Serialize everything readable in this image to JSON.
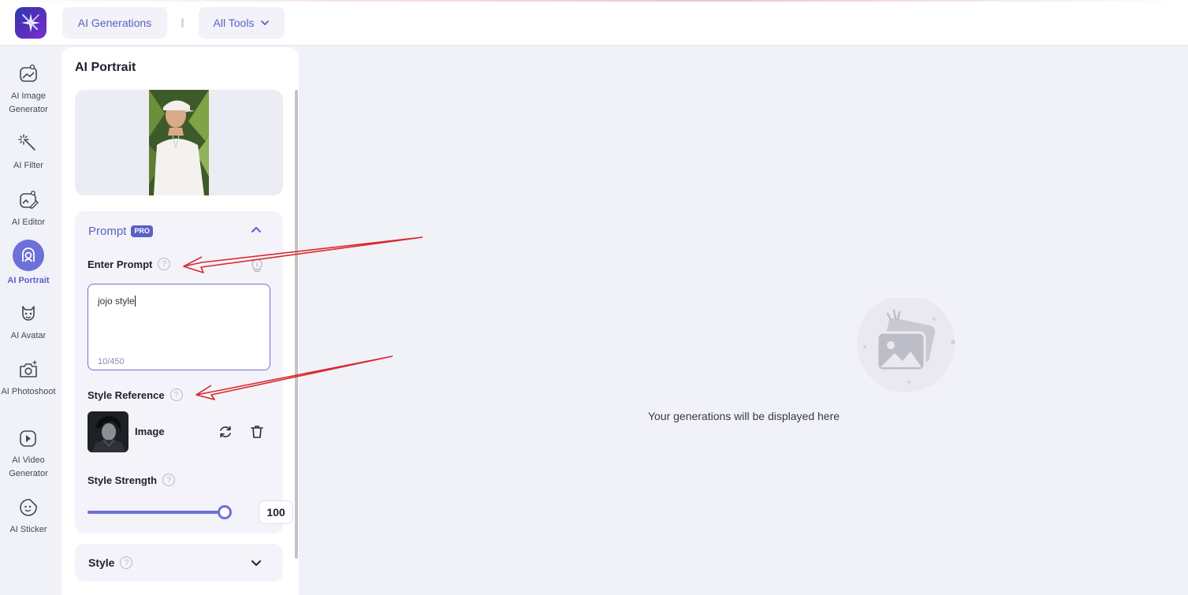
{
  "topbar": {
    "generations_label": "AI Generations",
    "tools_label": "All Tools"
  },
  "leftnav": {
    "items": [
      {
        "label": "AI Image Generator",
        "icon": "image-generator-icon"
      },
      {
        "label": "AI Filter",
        "icon": "magic-wand-icon"
      },
      {
        "label": "AI Editor",
        "icon": "image-edit-icon"
      },
      {
        "label": "AI Portrait",
        "icon": "portrait-icon",
        "active": true
      },
      {
        "label": "AI Avatar",
        "icon": "avatar-icon"
      },
      {
        "label": "AI Photoshoot",
        "icon": "camera-icon"
      },
      {
        "label": "AI Video Generator",
        "icon": "video-icon"
      },
      {
        "label": "AI Sticker",
        "icon": "sticker-icon"
      }
    ]
  },
  "panel": {
    "title": "AI Portrait",
    "prompt_section": {
      "title": "Prompt",
      "badge": "PRO",
      "enter_prompt_label": "Enter Prompt",
      "prompt_value": "jojo style",
      "char_count": "10/450",
      "style_reference_label": "Style Reference",
      "reference_label": "Image",
      "style_strength_label": "Style Strength",
      "style_strength_value": "100",
      "style_strength_level": 1.0
    },
    "style_section": {
      "title": "Style"
    },
    "help_glyph": "?"
  },
  "main": {
    "empty_message": "Your generations will be displayed here"
  },
  "colors": {
    "accent": "#5b5fc7",
    "annotation_red": "#d9282f"
  }
}
